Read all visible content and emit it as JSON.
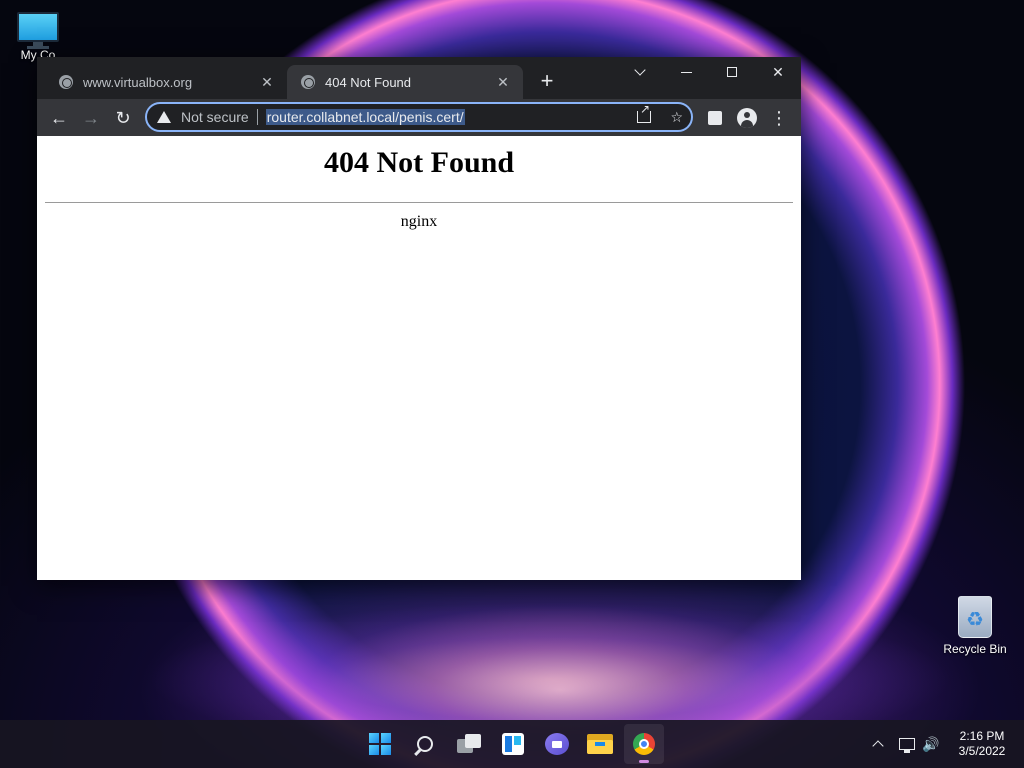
{
  "desktop": {
    "icons": [
      {
        "label": "My Co"
      },
      {
        "label": "Recycle Bin"
      }
    ]
  },
  "browser": {
    "tabs": [
      {
        "title": "www.virtualbox.org",
        "active": false
      },
      {
        "title": "404 Not Found",
        "active": true
      }
    ],
    "new_tab": "+",
    "toolbar": {
      "security_label": "Not secure",
      "url": "router.collabnet.local/penis.cert/"
    },
    "window_controls": {
      "close": "✕"
    }
  },
  "page": {
    "heading": "404 Not Found",
    "server": "nginx"
  },
  "taskbar": {
    "apps": [
      "start",
      "search",
      "task-view",
      "widgets",
      "chat",
      "file-explorer",
      "chrome"
    ],
    "active_app": "chrome",
    "clock": {
      "time": "2:16 PM",
      "date": "3/5/2022"
    }
  },
  "colors": {
    "accent": "#8ab4f8",
    "tab_active": "#35363a",
    "tabstrip": "#202124"
  }
}
